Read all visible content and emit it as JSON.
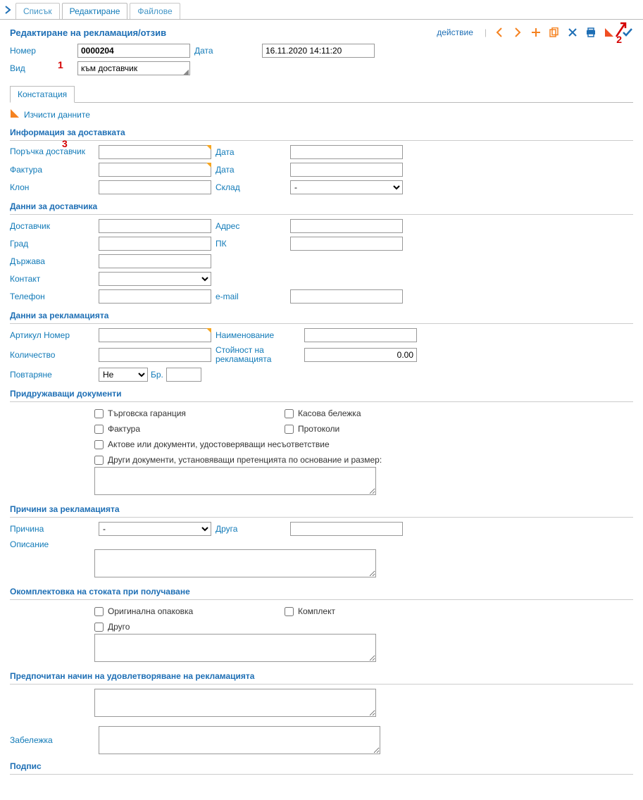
{
  "tabs": {
    "list": "Списък",
    "edit": "Редактиране",
    "files": "Файлове"
  },
  "page_title": "Редактиране на рекламация/отзив",
  "action_label": "действие",
  "annotations": {
    "one": "1",
    "two": "2",
    "three": "3"
  },
  "header_form": {
    "number_label": "Номер",
    "number_value": "0000204",
    "date_label": "Дата",
    "date_value": "16.11.2020 14:11:20",
    "type_label": "Вид",
    "type_value": "към доставчик"
  },
  "subtab_ascert": "Констатация",
  "clear_data": "Изчисти данните",
  "sec_delivery": "Информация за доставката",
  "delivery": {
    "order_label": "Поръчка доставчик",
    "date_label": "Дата",
    "invoice_label": "Фактура",
    "branch_label": "Клон",
    "warehouse_label": "Склад",
    "warehouse_value": "-"
  },
  "sec_supplier": "Данни за доставчика",
  "supplier": {
    "supplier_label": "Доставчик",
    "address_label": "Адрес",
    "city_label": "Град",
    "zip_label": "ПК",
    "country_label": "Държава",
    "contact_label": "Контакт",
    "phone_label": "Телефон",
    "email_label": "e-mail"
  },
  "sec_claim": "Данни за рекламацията",
  "claim": {
    "art_label": "Артикул Номер",
    "name_label": "Наименование",
    "qty_label": "Количество",
    "value_label": "Стойност на рекламацията",
    "value_value": "0.00",
    "repeat_label": "Повтаряне",
    "repeat_value": "Не",
    "count_label": "Бр."
  },
  "sec_docs": "Придружаващи документи",
  "docs": {
    "warranty": "Търговска гаранция",
    "receipt": "Касова бележка",
    "invoice": "Фактура",
    "protocols": "Протоколи",
    "acts": "Актове или документи, удостоверяващи несъответствие",
    "other": "Други документи, установяващи претенцията по основание и размер:"
  },
  "sec_reasons": "Причини за рекламацията",
  "reasons": {
    "reason_label": "Причина",
    "reason_value": "-",
    "other_label": "Друга",
    "desc_label": "Описание"
  },
  "sec_packaging": "Окомплектовка на стоката при получаване",
  "packaging": {
    "orig": "Оригинална опаковка",
    "set": "Комплект",
    "other": "Друго"
  },
  "sec_preferred": "Предпочитан начин на удовлетворяване на рекламацията",
  "note_label": "Забележка",
  "sec_sign": "Подпис"
}
